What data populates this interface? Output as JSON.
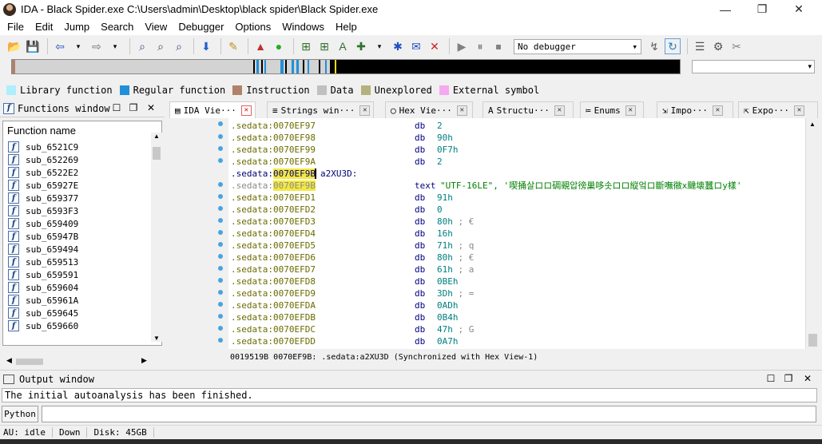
{
  "window": {
    "title": "IDA - Black Spider.exe C:\\Users\\admin\\Desktop\\black spider\\Black Spider.exe",
    "minimize": "—",
    "maximize": "❐",
    "close": "✕"
  },
  "menu": [
    "File",
    "Edit",
    "Jump",
    "Search",
    "View",
    "Debugger",
    "Options",
    "Windows",
    "Help"
  ],
  "toolbar": {
    "debugger_select": "No debugger",
    "dropdown_arrow": "▾"
  },
  "legend": [
    {
      "label": "Library function",
      "color": "#aeeefd"
    },
    {
      "label": "Regular function",
      "color": "#2090d8"
    },
    {
      "label": "Instruction",
      "color": "#b0826a"
    },
    {
      "label": "Data",
      "color": "#c0c0c0"
    },
    {
      "label": "Unexplored",
      "color": "#b4b27c"
    },
    {
      "label": "External symbol",
      "color": "#f6a8f0"
    }
  ],
  "functions_window": {
    "title": "Functions window",
    "column_header": "Function name",
    "functions": [
      "sub_6521C9",
      "sub_652269",
      "sub_6522E2",
      "sub_65927E",
      "sub_659377",
      "sub_6593F3",
      "sub_659409",
      "sub_65947B",
      "sub_659494",
      "sub_659513",
      "sub_659591",
      "sub_659604",
      "sub_65961A",
      "sub_659645",
      "sub_659660"
    ]
  },
  "tabs": [
    {
      "label": "IDA Vie···",
      "icon": "▤",
      "active": true
    },
    {
      "label": "Strings win···",
      "icon": "≡",
      "active": false
    },
    {
      "label": "Hex Vie···",
      "icon": "◯",
      "active": false
    },
    {
      "label": "Structu···",
      "icon": "A",
      "active": false
    },
    {
      "label": "Enums",
      "icon": "≔",
      "active": false
    },
    {
      "label": "Impo···",
      "icon": "⇲",
      "active": false
    },
    {
      "label": "Expo···",
      "icon": "⇱",
      "active": false
    }
  ],
  "disasm": [
    {
      "addr": ".sedata:0070EF97",
      "op": "db",
      "arg": "2",
      "comment": ""
    },
    {
      "addr": ".sedata:0070EF98",
      "op": "db",
      "arg": "90h",
      "comment": ""
    },
    {
      "addr": ".sedata:0070EF99",
      "op": "db",
      "arg": "0F7h",
      "comment": ""
    },
    {
      "addr": ".sedata:0070EF9A",
      "op": "db",
      "arg": "2",
      "comment": ""
    },
    {
      "addr_seg": ".sedata:",
      "addr_hl": "0070EF9B",
      "label": "a2XU3D:"
    },
    {
      "addr_seg": ".sedata:",
      "addr_hl": "0070EF9B",
      "op": "text",
      "arg1": "\"UTF-16LE\"",
      "arg2": ", '喫捅살ロロ碉覡압徬巢哆솟ロロ縦엌ロ斷嘸幑x颹壊蠶ロy樣'"
    },
    {
      "addr": ".sedata:0070EFD1",
      "op": "db",
      "arg": "91h",
      "comment": ""
    },
    {
      "addr": ".sedata:0070EFD2",
      "op": "db",
      "arg": "0",
      "comment": ""
    },
    {
      "addr": ".sedata:0070EFD3",
      "op": "db",
      "arg": "80h",
      "comment": "; €"
    },
    {
      "addr": ".sedata:0070EFD4",
      "op": "db",
      "arg": "16h",
      "comment": ""
    },
    {
      "addr": ".sedata:0070EFD5",
      "op": "db",
      "arg": "71h",
      "comment": "; q"
    },
    {
      "addr": ".sedata:0070EFD6",
      "op": "db",
      "arg": "80h",
      "comment": "; €"
    },
    {
      "addr": ".sedata:0070EFD7",
      "op": "db",
      "arg": "61h",
      "comment": "; a"
    },
    {
      "addr": ".sedata:0070EFD8",
      "op": "db",
      "arg": "0BEh",
      "comment": ""
    },
    {
      "addr": ".sedata:0070EFD9",
      "op": "db",
      "arg": "3Dh",
      "comment": "; ="
    },
    {
      "addr": ".sedata:0070EFDA",
      "op": "db",
      "arg": "0ADh",
      "comment": ""
    },
    {
      "addr": ".sedata:0070EFDB",
      "op": "db",
      "arg": "0B4h",
      "comment": ""
    },
    {
      "addr": ".sedata:0070EFDC",
      "op": "db",
      "arg": "47h",
      "comment": "; G"
    },
    {
      "addr": ".sedata:0070EFDD",
      "op": "db",
      "arg": "0A7h",
      "comment": ""
    }
  ],
  "ida_status": "0019519B 0070EF9B: .sedata:a2XU3D (Synchronized with Hex View-1)",
  "output_window": {
    "title": "Output window",
    "message": "The initial autoanalysis has been finished."
  },
  "python_button": "Python",
  "statusbar": {
    "au": "AU:  idle",
    "direction": "Down",
    "disk": "Disk: 45GB"
  }
}
